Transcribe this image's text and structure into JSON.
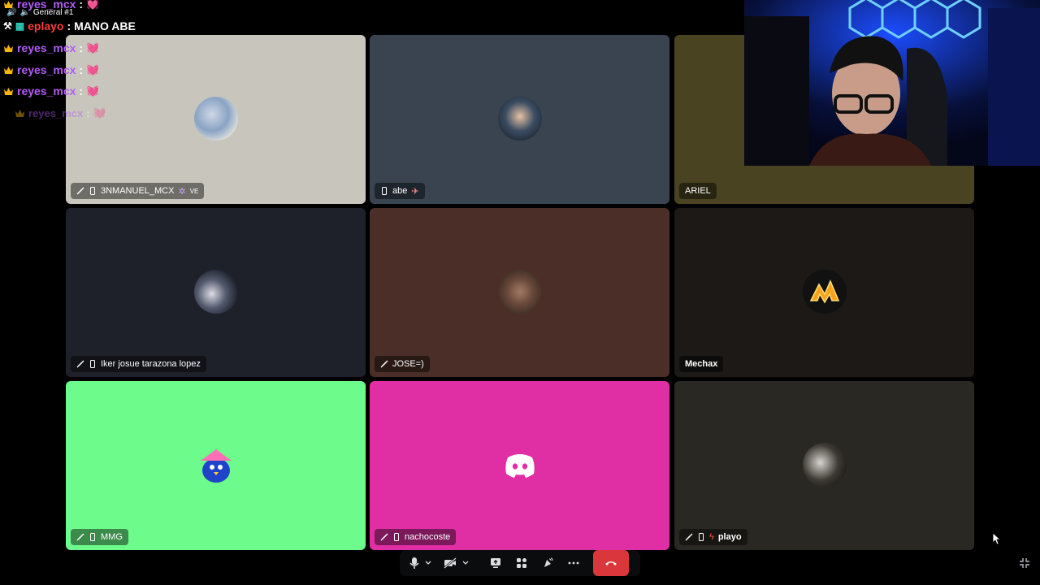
{
  "chat": {
    "channel_label": "General #1",
    "lines": [
      {
        "user": "reyes_mcx",
        "sep": ":",
        "message": "💓"
      },
      {
        "user": "eplayo",
        "sep": ":",
        "message": "MANO ABE"
      },
      {
        "user": "reyes_mcx",
        "sep": ":",
        "message": "💓"
      },
      {
        "user": "reyes_mcx",
        "sep": ":",
        "message": "💓"
      },
      {
        "user": "reyes_mcx",
        "sep": ":",
        "message": "💓"
      },
      {
        "user": "reyes_mcx",
        "sep": ":",
        "message": "💓"
      }
    ]
  },
  "tiles": [
    {
      "name": "3NMANUEL_MCX",
      "suffix": "VE",
      "bg": "#c8c6bc"
    },
    {
      "name": "abe",
      "bg": "#3a4450"
    },
    {
      "name": "ARIEL",
      "bg": "#4a4321"
    },
    {
      "name": "Iker josue tarazona lopez",
      "bg": "#1e2129"
    },
    {
      "name": "JOSE=)",
      "bg": "#4a2e27"
    },
    {
      "name": "Mechax",
      "bg": "#1c1916"
    },
    {
      "name": "MMG",
      "bg": "#6dfb8b"
    },
    {
      "name": "nachocoste",
      "bg": "#e02fa5"
    },
    {
      "name": "playo",
      "bg": "#2a2822"
    }
  ],
  "colors": {
    "username_purple": "#b25cf5",
    "eplayo_red": "#ff3a3a",
    "hangup_red": "#da373c",
    "crown_gold": "#f5b60a"
  },
  "icons": {
    "mic": "microphone-icon",
    "camera_off": "camera-off-icon",
    "screenshare": "screen-share-icon",
    "activities": "activities-icon",
    "soundboard": "soundboard-icon",
    "more": "more-icon",
    "hangup": "hang-up-icon",
    "minimize": "minimize-icon"
  }
}
